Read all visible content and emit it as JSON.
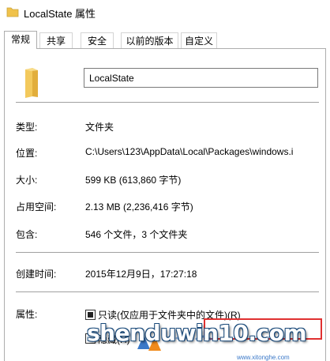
{
  "window": {
    "title": "LocalState 属性",
    "icon": "folder-icon"
  },
  "tabs": [
    {
      "label": "常规",
      "active": true
    },
    {
      "label": "共享",
      "active": false
    },
    {
      "label": "安全",
      "active": false
    },
    {
      "label": "以前的版本",
      "active": false
    },
    {
      "label": "自定义",
      "active": false
    }
  ],
  "general": {
    "folder_name": "LocalState",
    "folder_icon": "folder-icon",
    "folder_color": "#f0c24b",
    "rows": {
      "type": {
        "label": "类型:",
        "value": "文件夹"
      },
      "location": {
        "label": "位置:",
        "value": "C:\\Users\\123\\AppData\\Local\\Packages\\windows.i"
      },
      "size": {
        "label": "大小:",
        "value": "599 KB (613,860 字节)"
      },
      "size_on_disk": {
        "label": "占用空间:",
        "value": "2.13 MB (2,236,416 字节)"
      },
      "contains": {
        "label": "包含:",
        "value": "546 个文件，3 个文件夹"
      },
      "created": {
        "label": "创建时间:",
        "value": "2015年12月9日，17:27:18"
      }
    },
    "attributes": {
      "label": "属性:",
      "readonly": {
        "label": "只读(仅应用于文件夹中的文件)(R)",
        "checked": true
      },
      "hidden": {
        "label": "隐藏(H)",
        "checked": false
      }
    }
  },
  "highlight_color": "#e03030",
  "watermark": {
    "text": "shenduwin10.com",
    "sub": "www.xitonghe.com",
    "colors": {
      "blue": "#3a78c8",
      "orange": "#f08a1c"
    }
  }
}
